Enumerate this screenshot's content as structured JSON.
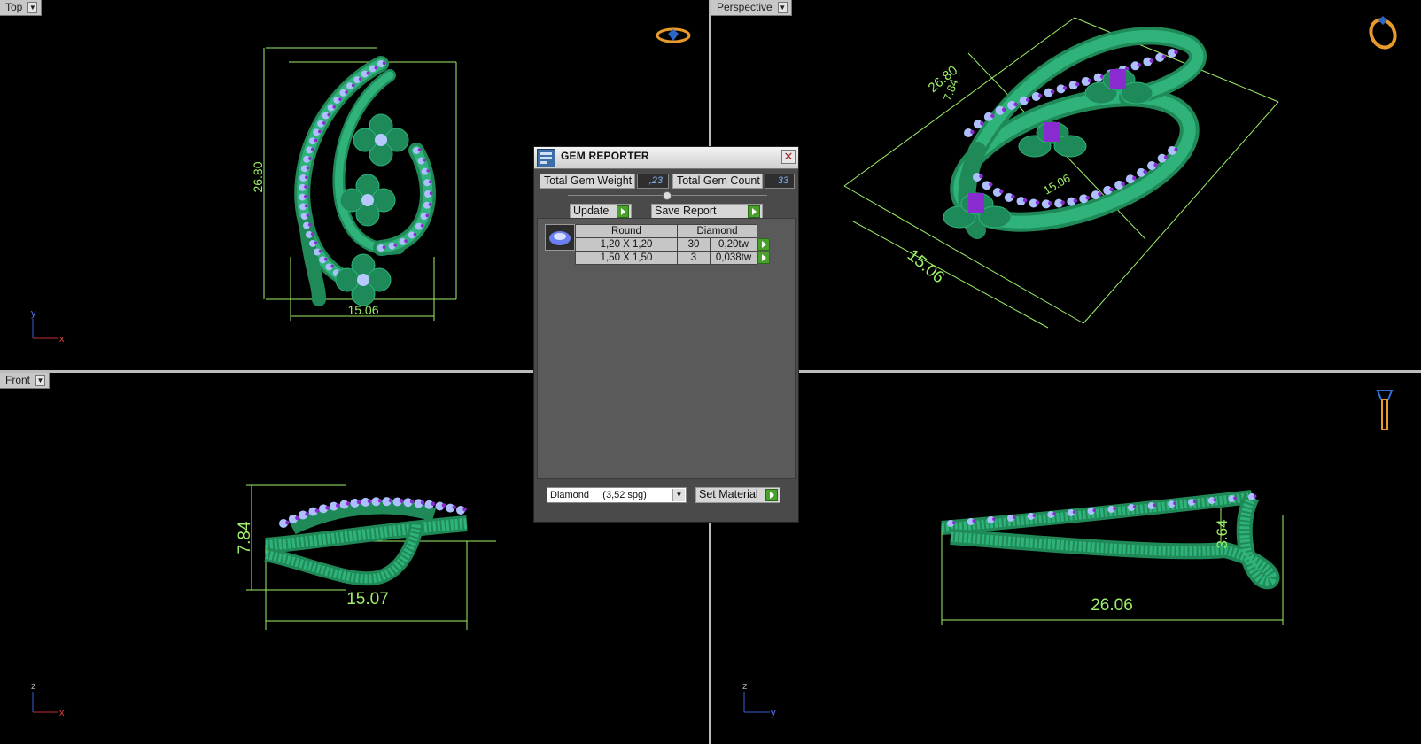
{
  "viewports": {
    "top": {
      "label": "Top",
      "dims": {
        "height": "26.80",
        "width": "15.06"
      },
      "axes": {
        "v": "y",
        "h": "x"
      }
    },
    "perspective": {
      "label": "Perspective",
      "dims": {
        "a": "26.80",
        "b": "7.84",
        "c": "15.06",
        "d": "15.06"
      }
    },
    "front": {
      "label": "Front",
      "dims": {
        "height": "7.84",
        "width": "15.07"
      },
      "axes": {
        "v": "z",
        "h": "x"
      }
    },
    "right": {
      "dims": {
        "height": "3.64",
        "width": "26.06"
      },
      "axes": {
        "v": "z",
        "h": "y"
      }
    }
  },
  "gem_reporter": {
    "title": "GEM REPORTER",
    "total_weight_label": "Total Gem Weight",
    "total_weight_value": ",23",
    "total_count_label": "Total Gem Count",
    "total_count_value": "33",
    "update_label": "Update",
    "save_label": "Save Report",
    "table": {
      "shape": "Round",
      "material": "Diamond",
      "rows": [
        {
          "size": "1,20 X 1,20",
          "count": "30",
          "weight": "0,20tw"
        },
        {
          "size": "1,50 X 1,50",
          "count": "3",
          "weight": "0,038tw"
        }
      ]
    },
    "material_select": "Diamond     (3,52 spg)",
    "set_material_label": "Set Material"
  },
  "icons": [
    "gem-reporter-app-icon",
    "close-icon",
    "go-arrow-icon",
    "diamond-gem-icon",
    "ring-top-icon",
    "ring-perspective-icon",
    "ring-side-icon",
    "dropdown-arrow-icon"
  ],
  "colors": {
    "wire_green": "#2fb37a",
    "gem_blue": "#9fb8ff",
    "prong_purple": "#8a2bd0",
    "dimension_green": "#9ef06a",
    "dialog_bg": "#4a4a4a"
  }
}
